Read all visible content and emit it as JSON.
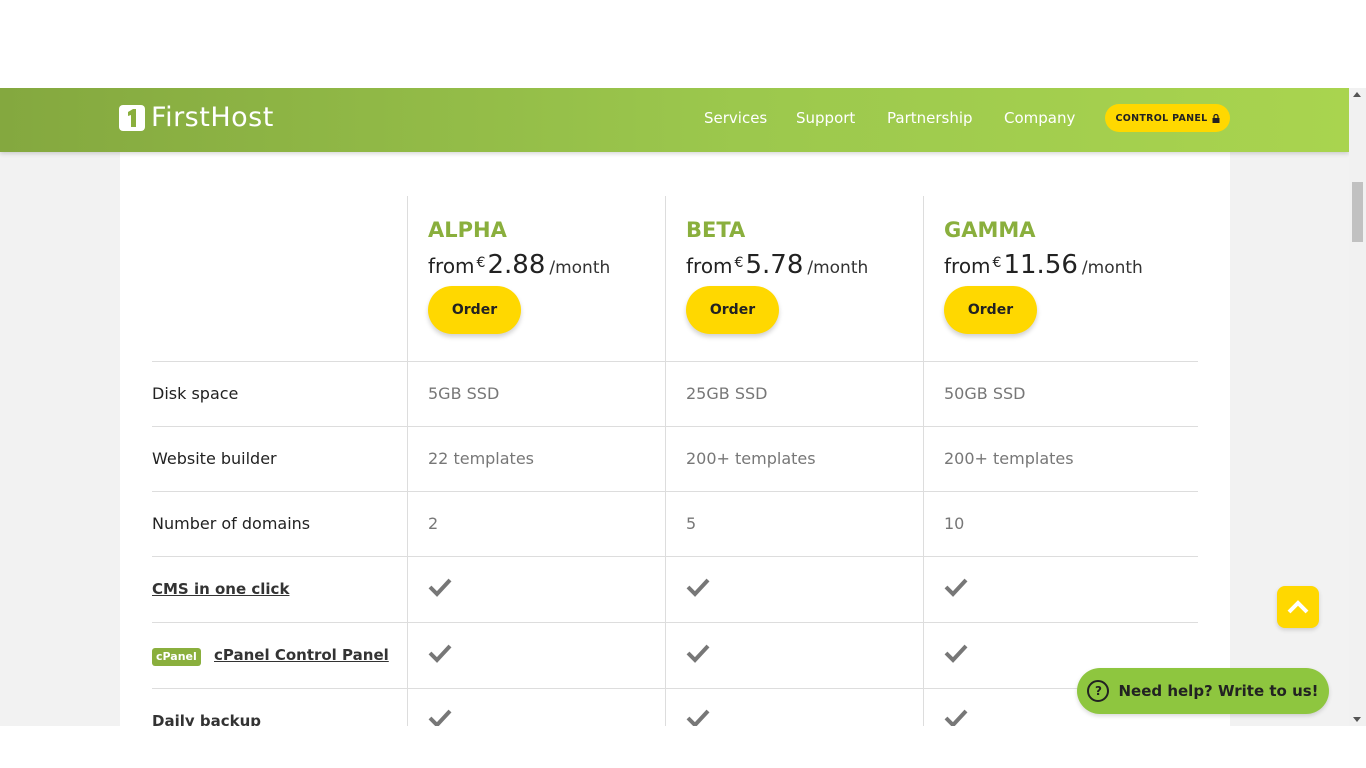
{
  "header": {
    "logo_text": "FirstHost",
    "nav": [
      "Services",
      "Support",
      "Partnership",
      "Company"
    ],
    "control_panel": "CONTROL PANEL"
  },
  "plans": [
    {
      "name": "ALPHA",
      "from": "from",
      "currency": "€",
      "price": "2.88",
      "period": "/month",
      "order": "Order"
    },
    {
      "name": "BETA",
      "from": "from",
      "currency": "€",
      "price": "5.78",
      "period": "/month",
      "order": "Order"
    },
    {
      "name": "GAMMA",
      "from": "from",
      "currency": "€",
      "price": "11.56",
      "period": "/month",
      "order": "Order"
    }
  ],
  "rows": [
    {
      "label": "Disk space",
      "values": [
        "5GB SSD",
        "25GB SSD",
        "50GB SSD"
      ]
    },
    {
      "label": "Website builder",
      "values": [
        "22 templates",
        "200+ templates",
        "200+ templates"
      ]
    },
    {
      "label": "Number of domains",
      "values": [
        "2",
        "5",
        "10"
      ]
    },
    {
      "label": "CMS in one click",
      "values": [
        "check",
        "check",
        "check"
      ]
    },
    {
      "label": "cPanel Control Panel",
      "badge": "cPanel",
      "values": [
        "check",
        "check",
        "check"
      ]
    },
    {
      "label": "Daily backup",
      "values": [
        "check",
        "check",
        "check"
      ]
    }
  ],
  "help": {
    "label": "Need help? Write to us!"
  },
  "colors": {
    "brand_green": "#8aaf3d",
    "accent_yellow": "#ffd800"
  }
}
